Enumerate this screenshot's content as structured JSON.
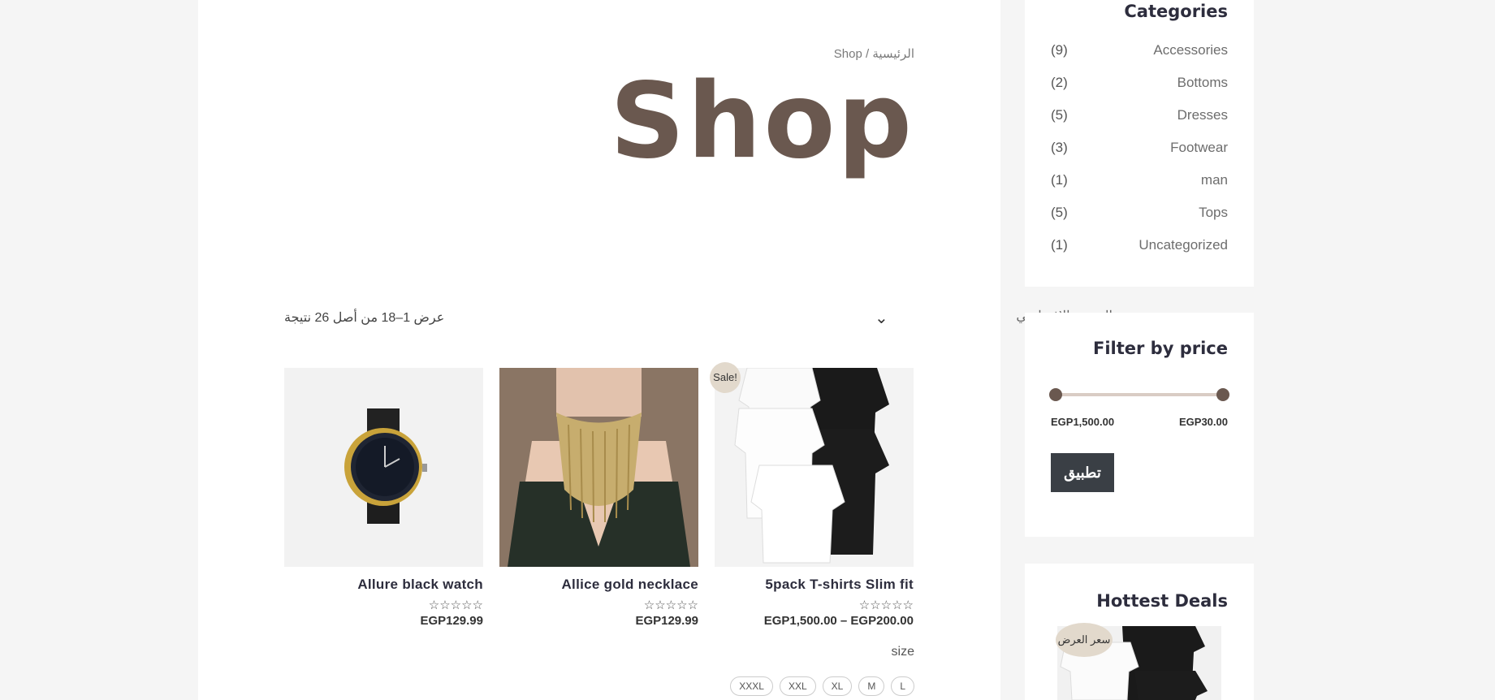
{
  "breadcrumb": "الرئيسية / Shop",
  "page_title": "Shop",
  "result_count": "عرض 1–18 من أصل 26 نتيجة",
  "ordering": {
    "selected": "الترتيب الافتراضي"
  },
  "products": [
    {
      "name": "5pack T-shirts Slim fit",
      "stars": "☆☆☆☆☆",
      "price": "EGP1,500.00 – EGP200.00",
      "badge": "Sale!"
    },
    {
      "name": "Allice gold necklace",
      "stars": "☆☆☆☆☆",
      "price": "EGP129.99"
    },
    {
      "name": "Allure black watch",
      "stars": "☆☆☆☆☆",
      "price": "EGP129.99"
    }
  ],
  "size_filter": {
    "label": "size",
    "options": [
      "L",
      "M",
      "XL",
      "XXL",
      "XXXL"
    ]
  },
  "sidebar": {
    "categories": {
      "title": "Categories",
      "items": [
        {
          "name": "Accessories",
          "count": "(9)"
        },
        {
          "name": "Bottoms",
          "count": "(2)"
        },
        {
          "name": "Dresses",
          "count": "(5)"
        },
        {
          "name": "Footwear",
          "count": "(3)"
        },
        {
          "name": "man",
          "count": "(1)"
        },
        {
          "name": "Tops",
          "count": "(5)"
        },
        {
          "name": "Uncategorized",
          "count": "(1)"
        }
      ]
    },
    "price_filter": {
      "title": "Filter by price",
      "min": "EGP30.00",
      "max": "EGP1,500.00",
      "apply_label": "تطبيق"
    },
    "deals": {
      "title": "Hottest Deals",
      "badge": "سعر العرض"
    }
  },
  "colors": {
    "accent": "#6a584f",
    "button": "#3a3f45",
    "badge": "#e2d9cc"
  }
}
